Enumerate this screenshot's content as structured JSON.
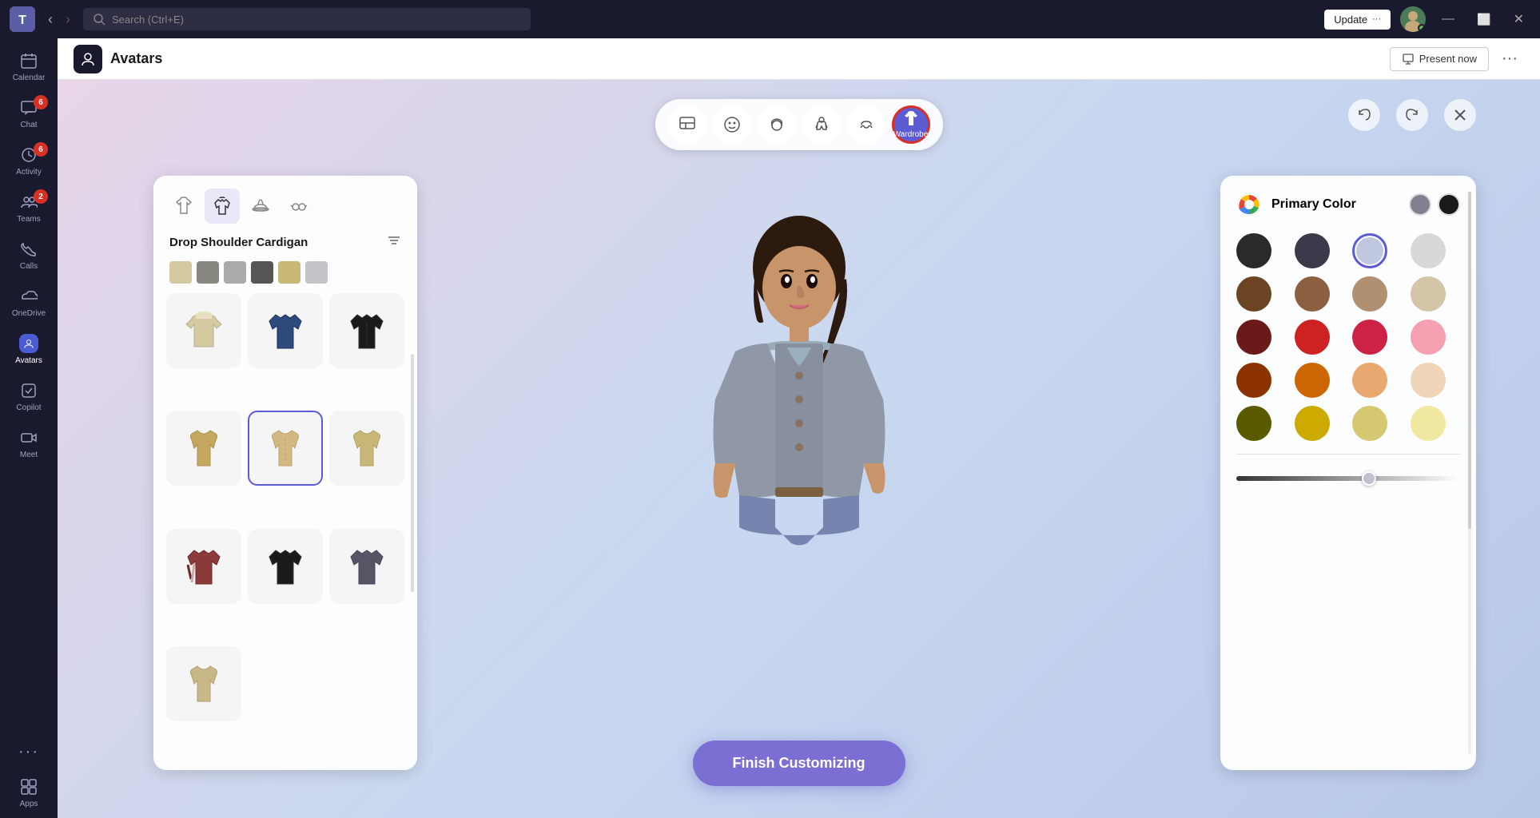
{
  "titleBar": {
    "searchPlaceholder": "Search (Ctrl+E)",
    "updateLabel": "Update",
    "updateMore": "···"
  },
  "sidebar": {
    "items": [
      {
        "id": "calendar",
        "label": "Calendar",
        "icon": "📅",
        "badge": null,
        "active": false
      },
      {
        "id": "chat",
        "label": "Chat",
        "icon": "💬",
        "badge": "6",
        "active": false
      },
      {
        "id": "activity",
        "label": "Activity",
        "icon": "🔔",
        "badge": "6",
        "active": false
      },
      {
        "id": "teams",
        "label": "Teams",
        "icon": "👥",
        "badge": "2",
        "active": false
      },
      {
        "id": "calls",
        "label": "Calls",
        "icon": "📞",
        "badge": null,
        "active": false
      },
      {
        "id": "onedrive",
        "label": "OneDrive",
        "icon": "☁️",
        "badge": null,
        "active": false
      },
      {
        "id": "avatars",
        "label": "Avatars",
        "icon": "🧑",
        "badge": null,
        "active": true
      },
      {
        "id": "copilot",
        "label": "Copilot",
        "icon": "🤖",
        "badge": null,
        "active": false
      },
      {
        "id": "meet",
        "label": "Meet",
        "icon": "📹",
        "badge": null,
        "active": false
      },
      {
        "id": "more",
        "label": "···",
        "icon": "···",
        "badge": null,
        "active": false
      },
      {
        "id": "apps",
        "label": "Apps",
        "icon": "⊞",
        "badge": null,
        "active": false
      }
    ]
  },
  "appHeader": {
    "title": "Avatars",
    "presentLabel": "Present now",
    "moreLabel": "···"
  },
  "toolbar": {
    "buttons": [
      {
        "id": "template",
        "icon": "🖼",
        "label": ""
      },
      {
        "id": "face",
        "icon": "😐",
        "label": ""
      },
      {
        "id": "hair",
        "icon": "👤",
        "label": ""
      },
      {
        "id": "body",
        "icon": "👕",
        "label": ""
      },
      {
        "id": "accessories",
        "icon": "✋",
        "label": ""
      },
      {
        "id": "wardrobe",
        "icon": "👕",
        "label": "Wardrobe",
        "active": true,
        "selected": true
      }
    ],
    "undoLabel": "↩",
    "redoLabel": "↪",
    "closeLabel": "✕"
  },
  "leftPanel": {
    "tabs": [
      {
        "id": "tshirt",
        "icon": "👕"
      },
      {
        "id": "jacket",
        "icon": "🧥",
        "active": true
      },
      {
        "id": "hat",
        "icon": "🎩"
      },
      {
        "id": "glasses",
        "icon": "👓"
      }
    ],
    "title": "Drop Shoulder Cardigan",
    "items": [
      {
        "id": 1,
        "color": "#d4c9a0"
      },
      {
        "id": 2,
        "color": "#2c4a7c"
      },
      {
        "id": 3,
        "color": "#1a1a1a"
      },
      {
        "id": 4,
        "color": "#c4a860"
      },
      {
        "id": 5,
        "color": "#d4b882",
        "selected": true
      },
      {
        "id": 6,
        "color": "#c8b878"
      },
      {
        "id": 7,
        "color": "#8b3a3a"
      },
      {
        "id": 8,
        "color": "#1a1a1a"
      },
      {
        "id": 9,
        "color": "#555566"
      },
      {
        "id": 10,
        "color": "#c8b888"
      }
    ],
    "swatches": [
      "#d4c9a0",
      "#888880",
      "#aaaaaa",
      "#555555",
      "#c8b878",
      "#c4c4c8"
    ]
  },
  "rightPanel": {
    "title": "Primary Color",
    "colors": [
      {
        "id": 1,
        "hex": "#2a2a2a"
      },
      {
        "id": 2,
        "hex": "#3a3a4a"
      },
      {
        "id": 3,
        "hex": "#c0c8e0",
        "selected": true
      },
      {
        "id": 4,
        "hex": "#d8d8d8"
      },
      {
        "id": 5,
        "hex": "#6b4423"
      },
      {
        "id": 6,
        "hex": "#8b6040"
      },
      {
        "id": 7,
        "hex": "#b09070"
      },
      {
        "id": 8,
        "hex": "#d4c4a8"
      },
      {
        "id": 9,
        "hex": "#6b1a1a"
      },
      {
        "id": 10,
        "hex": "#cc2222"
      },
      {
        "id": 11,
        "hex": "#cc2244"
      },
      {
        "id": 12,
        "hex": "#f4a0b0"
      },
      {
        "id": 13,
        "hex": "#8b3200"
      },
      {
        "id": 14,
        "hex": "#cc6600"
      },
      {
        "id": 15,
        "hex": "#e8a870"
      },
      {
        "id": 16,
        "hex": "#f0d4b8"
      },
      {
        "id": 17,
        "hex": "#5a5a00"
      },
      {
        "id": 18,
        "hex": "#ccaa00"
      },
      {
        "id": 19,
        "hex": "#d4c870"
      },
      {
        "id": 20,
        "hex": "#f0e8a0"
      }
    ],
    "currentColors": [
      "#808090",
      "#1a1a1a"
    ],
    "sliderValue": 60
  },
  "finishButton": {
    "label": "Finish Customizing"
  }
}
